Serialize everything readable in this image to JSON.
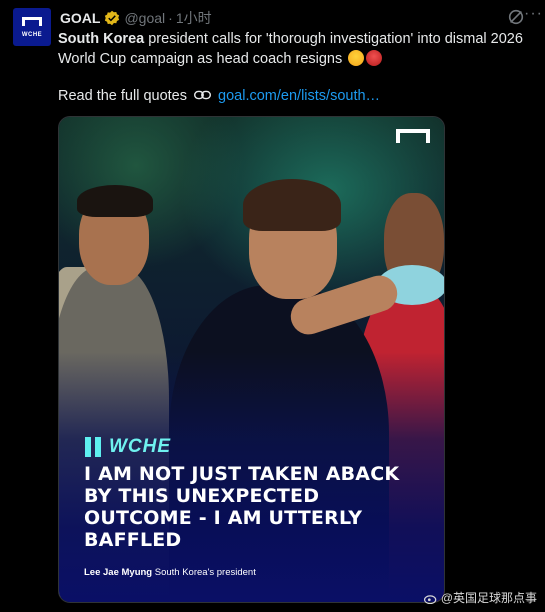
{
  "post": {
    "author_name": "GOAL",
    "handle": "@goal",
    "separator": "·",
    "time": "1小时",
    "more_label": "···",
    "headline_bold": "South Korea",
    "headline_rest": " president calls for 'thorough investigation' into dismal 2026 World Cup campaign as head coach resigns",
    "quotes_prefix": "Read the full quotes",
    "link_text": "goal.com/en/lists/south…"
  },
  "avatar": {
    "label": "WCHE"
  },
  "media": {
    "brand": "WCHE",
    "quote": "I AM NOT JUST TAKEN ABACK BY THIS UNEXPECTED OUTCOME - I AM UTTERLY BAFFLED",
    "attribution_name": "Lee Jae Myung",
    "attribution_title": " South Korea's president"
  },
  "watermark": {
    "text": "@英国足球那点事"
  },
  "colors": {
    "link": "#1d9bf0",
    "verified": "#e2b719",
    "brand_cyan": "#6ff2ef",
    "background": "#000000"
  },
  "icons": [
    "verified-badge-icon",
    "grok-icon",
    "more-icon",
    "link-icon",
    "goal-logo-icon",
    "weibo-icon",
    "emoji-grimacing",
    "emoji-angry"
  ]
}
